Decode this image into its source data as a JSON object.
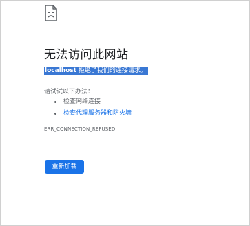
{
  "error_page": {
    "icon": "sad-page-icon",
    "title": "无法访问此网站",
    "description": {
      "host": "localhost",
      "message": " 拒绝了我们的连接请求。"
    },
    "try_label": "请试试以下办法：",
    "suggestions": [
      "检查网络连接",
      "检查代理服务器和防火墙"
    ],
    "error_code": "ERR_CONNECTION_REFUSED",
    "reload_label": "重新加载"
  },
  "colors": {
    "accent": "#1a73e8",
    "selection": "#3a78d4",
    "text_primary": "#202124",
    "text_secondary": "#5f6368"
  }
}
